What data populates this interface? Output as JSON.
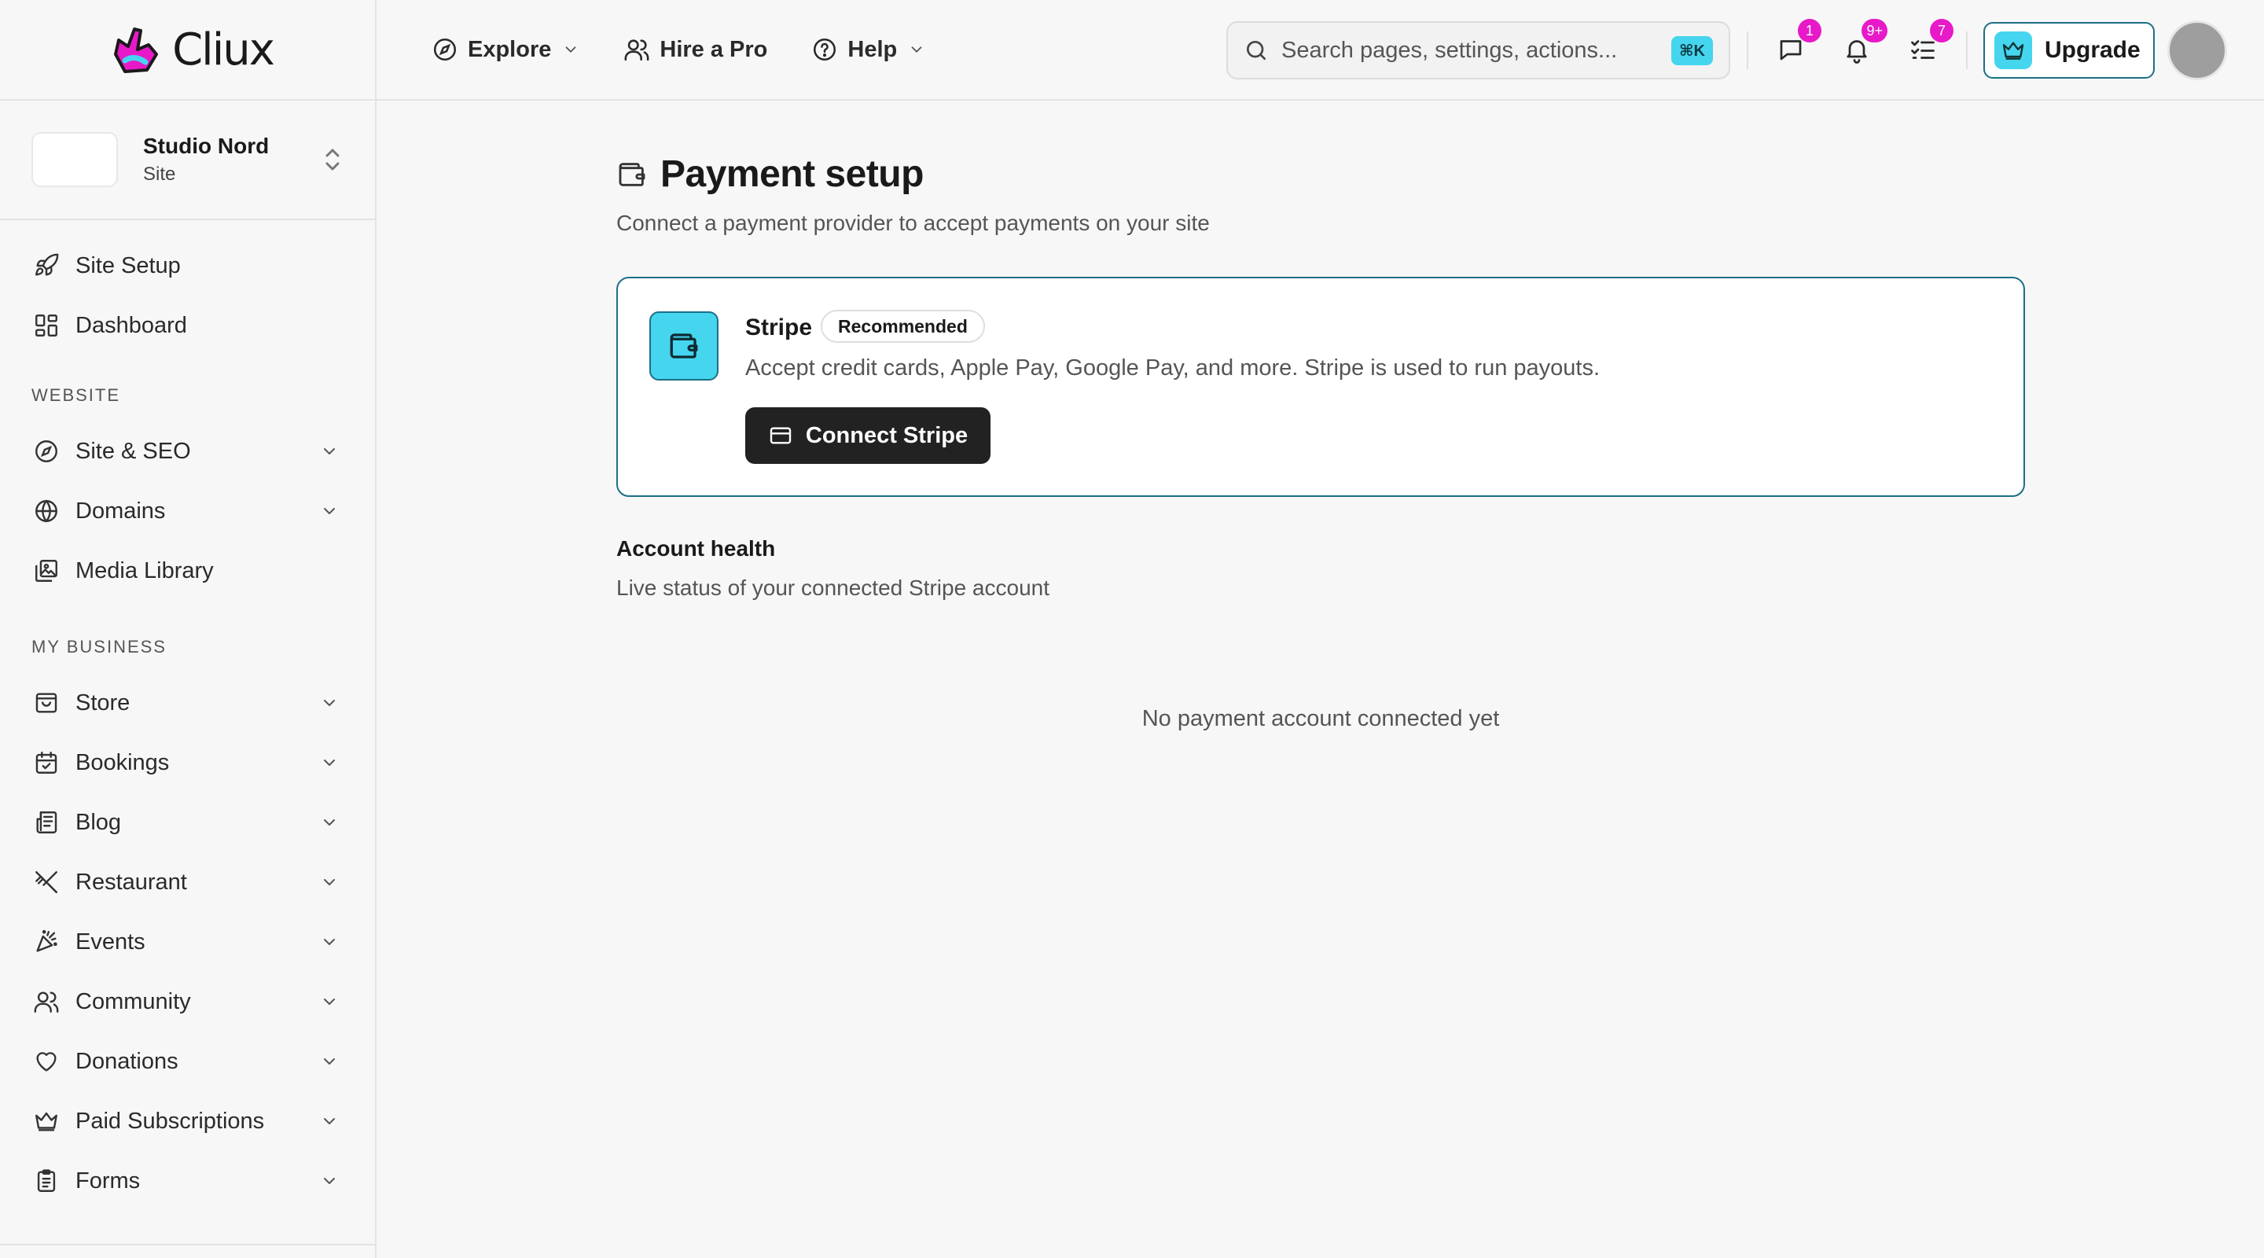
{
  "brand": {
    "name": "Cliux"
  },
  "site": {
    "name": "Studio Nord",
    "type": "Site"
  },
  "sidebar": {
    "top_items": [
      {
        "label": "Site Setup",
        "icon": "rocket-icon"
      },
      {
        "label": "Dashboard",
        "icon": "dashboard-icon"
      }
    ],
    "sections": [
      {
        "title": "WEBSITE",
        "items": [
          {
            "label": "Site & SEO",
            "icon": "compass-icon",
            "expandable": true
          },
          {
            "label": "Domains",
            "icon": "globe-icon",
            "expandable": true
          },
          {
            "label": "Media Library",
            "icon": "image-gallery-icon",
            "expandable": false
          }
        ]
      },
      {
        "title": "MY BUSINESS",
        "items": [
          {
            "label": "Store",
            "icon": "shopping-bag-icon",
            "expandable": true
          },
          {
            "label": "Bookings",
            "icon": "calendar-icon",
            "expandable": true
          },
          {
            "label": "Blog",
            "icon": "newspaper-icon",
            "expandable": true
          },
          {
            "label": "Restaurant",
            "icon": "utensils-icon",
            "expandable": true
          },
          {
            "label": "Events",
            "icon": "party-popper-icon",
            "expandable": true
          },
          {
            "label": "Community",
            "icon": "users-icon",
            "expandable": true
          },
          {
            "label": "Donations",
            "icon": "heart-icon",
            "expandable": true
          },
          {
            "label": "Paid Subscriptions",
            "icon": "crown-icon",
            "expandable": true
          },
          {
            "label": "Forms",
            "icon": "clipboard-icon",
            "expandable": true
          }
        ]
      }
    ]
  },
  "topbar": {
    "nav": [
      {
        "label": "Explore",
        "icon": "compass-icon",
        "dropdown": true
      },
      {
        "label": "Hire a Pro",
        "icon": "users-icon",
        "dropdown": false
      },
      {
        "label": "Help",
        "icon": "help-circle-icon",
        "dropdown": true
      }
    ],
    "search": {
      "placeholder": "Search pages, settings, actions...",
      "shortcut": "⌘K"
    },
    "badges": {
      "messages": "1",
      "notifications": "9+",
      "tasks": "7"
    },
    "upgrade_label": "Upgrade"
  },
  "main": {
    "title": "Payment setup",
    "subtitle": "Connect a payment provider to accept payments on your site",
    "provider": {
      "name": "Stripe",
      "badge": "Recommended",
      "description": "Accept credit cards, Apple Pay, Google Pay, and more. Stripe is used to run payouts.",
      "button_label": "Connect Stripe"
    },
    "health": {
      "title": "Account health",
      "subtitle": "Live status of your connected Stripe account",
      "empty": "No payment account connected yet"
    }
  },
  "colors": {
    "accent": "#45d5ef",
    "accent_border": "#1c6f86",
    "badge": "#e719c8",
    "primary_button": "#222222"
  }
}
